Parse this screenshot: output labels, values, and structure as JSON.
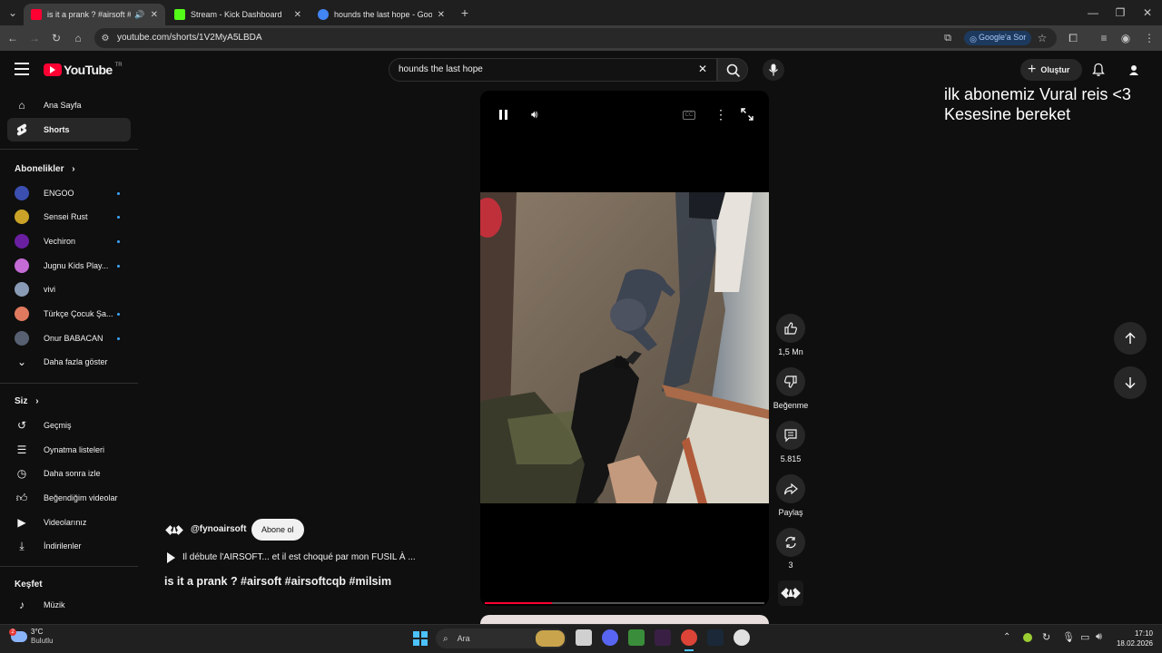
{
  "browser": {
    "tabs": [
      {
        "label": "is it a prank ? #airsoft #airs",
        "favicon_color": "#ff0033",
        "active": true
      },
      {
        "label": "Stream - Kick Dashboard",
        "favicon_color": "#53fc18",
        "active": false
      },
      {
        "label": "hounds the last hope - Google",
        "favicon_color": "#4285f4",
        "active": false
      }
    ],
    "url": "youtube.com/shorts/1V2MyA5LBDA",
    "google_sor": "Google'a Sor"
  },
  "yt": {
    "logo_text": "YouTube",
    "logo_region": "TR",
    "search_value": "hounds the last hope",
    "create_label": "Oluştur"
  },
  "sidebar": {
    "main": [
      {
        "label": "Ana Sayfa",
        "icon": "home-icon"
      },
      {
        "label": "Shorts",
        "icon": "shorts-icon"
      }
    ],
    "subscriptions_title": "Abonelikler",
    "subscriptions": [
      {
        "label": "ENGOO",
        "color": "#3a4fb0",
        "dot": true
      },
      {
        "label": "Sensei Rust",
        "color": "#c9a227",
        "dot": true
      },
      {
        "label": "Vechiron",
        "color": "#6a1fa0",
        "dot": true
      },
      {
        "label": "Jugnu Kids Play...",
        "color": "#c46bd6",
        "dot": true
      },
      {
        "label": "vivi",
        "color": "#8a9bb5",
        "dot": false
      },
      {
        "label": "Türkçe Çocuk Şa...",
        "color": "#e07a5f",
        "dot": true
      },
      {
        "label": "Onur BABACAN",
        "color": "#566070",
        "dot": true
      }
    ],
    "show_more": "Daha fazla göster",
    "you_title": "Siz",
    "you_items": [
      {
        "label": "Geçmiş",
        "icon": "history-icon"
      },
      {
        "label": "Oynatma listeleri",
        "icon": "playlist-icon"
      },
      {
        "label": "Daha sonra izle",
        "icon": "clock-icon"
      },
      {
        "label": "Beğendiğim videolar",
        "icon": "thumb-up-icon"
      },
      {
        "label": "Videolarınız",
        "icon": "video-icon"
      },
      {
        "label": "İndirilenler",
        "icon": "download-icon"
      }
    ],
    "explore_title": "Keşfet",
    "explore_items": [
      {
        "label": "Müzik",
        "icon": "music-icon"
      }
    ]
  },
  "short": {
    "channel": "@fynoairsoft",
    "subscribe": "Abone ol",
    "description": "Il débute l'AIRSOFT... et il est choqué par mon FUSIL À ...",
    "title": "is it a prank ? #airsoft #airsoftcqb #milsim",
    "likes": "1,5 Mn",
    "dislike": "Beğenme",
    "comments": "5.815",
    "share": "Paylaş",
    "remix": "3",
    "progress": 0.24
  },
  "overlay_text": {
    "line1": "ilk abonemiz Vural reis <3",
    "line2": "Kesesine bereket"
  },
  "taskbar": {
    "temp": "3°C",
    "weather": "Bulutlu",
    "search": "Ara",
    "time": "17:10",
    "date": "18.02.2026"
  }
}
